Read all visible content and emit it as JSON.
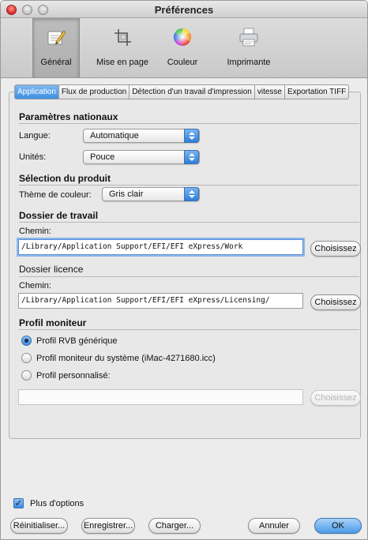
{
  "window": {
    "title": "Préférences"
  },
  "toolbar": {
    "items": [
      {
        "label": "Général",
        "icon": "general-prefs-icon",
        "selected": true
      },
      {
        "label": "Mise en page",
        "icon": "crop-icon"
      },
      {
        "label": "Couleur",
        "icon": "color-wheel-icon"
      },
      {
        "label": "Imprimante",
        "icon": "printer-icon"
      }
    ]
  },
  "tabs": [
    {
      "label": "Application",
      "active": true
    },
    {
      "label": "Flux de production"
    },
    {
      "label": "Détection d'un travail d'impression"
    },
    {
      "label": "vitesse"
    },
    {
      "label": "Exportation TIFF"
    }
  ],
  "national": {
    "title": "Paramètres nationaux",
    "language_label": "Langue:",
    "language_value": "Automatique",
    "units_label": "Unités:",
    "units_value": "Pouce"
  },
  "product": {
    "title": "Sélection du produit",
    "theme_label": "Thème de couleur:",
    "theme_value": "Gris clair"
  },
  "workfolder": {
    "title": "Dossier de travail",
    "path_label": "Chemin:",
    "path_value": "/Library/Application Support/EFI/EFI eXpress/Work",
    "choose_label": "Choisissez"
  },
  "license": {
    "title": "Dossier licence",
    "path_label": "Chemin:",
    "path_value": "/Library/Application Support/EFI/EFI eXpress/Licensing/",
    "choose_label": "Choisissez"
  },
  "monitor": {
    "title": "Profil moniteur",
    "options": [
      {
        "label": "Profil RVB générique",
        "selected": true
      },
      {
        "label": "Profil moniteur du système (iMac-4271680.icc)",
        "selected": false
      },
      {
        "label": "Profil personnalisé:",
        "selected": false
      }
    ],
    "custom_path_value": "",
    "choose_label": "Choisissez"
  },
  "footer": {
    "more_options_label": "Plus d'options",
    "more_options_checked": true,
    "reset_label": "Réinitialiser...",
    "save_label": "Enregistrer...",
    "load_label": "Charger...",
    "cancel_label": "Annuler",
    "ok_label": "OK"
  },
  "colors": {
    "accent": "#3d8fe0",
    "window_bg": "#ececec"
  }
}
